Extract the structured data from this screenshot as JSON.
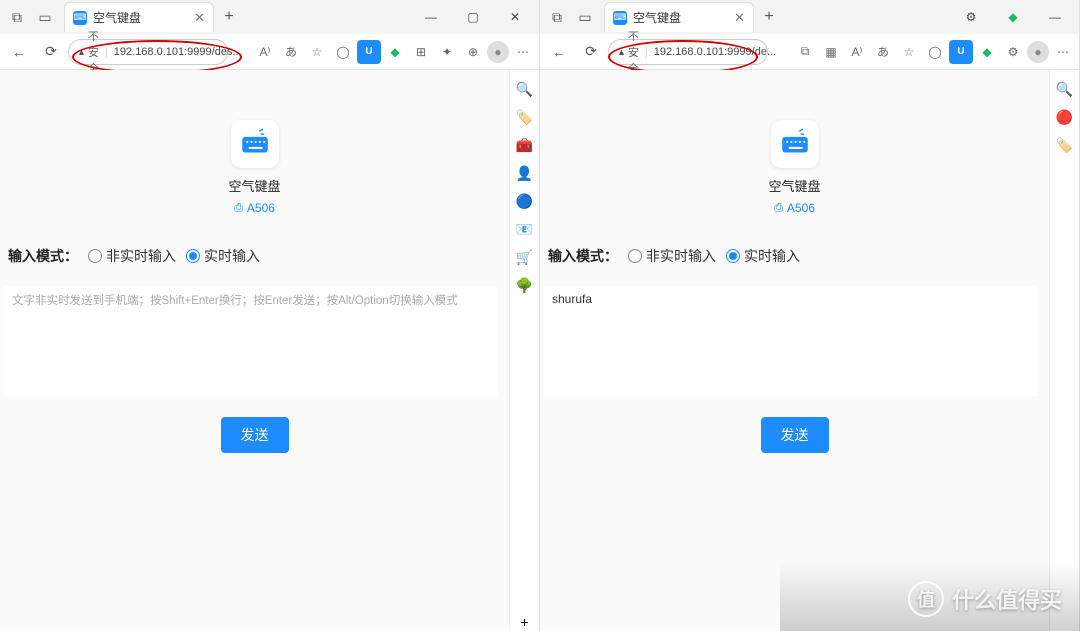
{
  "left": {
    "tab": {
      "title": "空气键盘"
    },
    "addr": {
      "warn": "不安全",
      "url": "192.168.0.101:9999/des..."
    },
    "app": {
      "title": "空气键盘",
      "device": "A506",
      "mode_label": "输入模式：",
      "opt1": "非实时输入",
      "opt2": "实时输入",
      "placeholder": "文字非实时发送到手机端；按Shift+Enter换行；按Enter发送；按Alt/Option切换输入模式",
      "value": "",
      "send": "发送"
    }
  },
  "right": {
    "tab": {
      "title": "空气键盘"
    },
    "addr": {
      "warn": "不安全",
      "url": "192.168.0.101:9999/de..."
    },
    "app": {
      "title": "空气键盘",
      "device": "A506",
      "mode_label": "输入模式：",
      "opt1": "非实时输入",
      "opt2": "实时输入",
      "placeholder": "",
      "value": "shurufa",
      "send": "发送"
    }
  },
  "watermark": {
    "logo": "值",
    "text": "什么值得买"
  }
}
